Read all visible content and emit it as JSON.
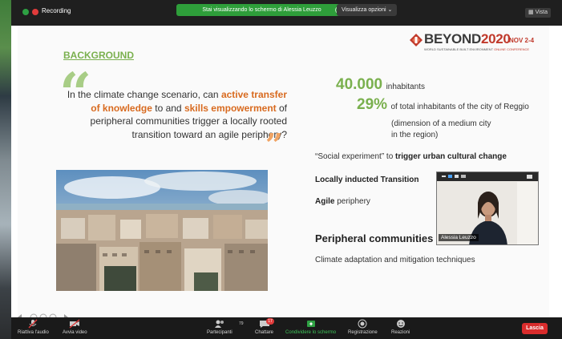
{
  "topbar": {
    "recording_label": "Recording",
    "share_notice": "Stai visualizzando lo schermo di Alessia Leuzzo",
    "view_options": "Visualizza opzioni ⌄",
    "view_button": "Vista"
  },
  "slide": {
    "logo": {
      "title_main": "BEYOND",
      "title_year": "2020",
      "date": "NOV 2-4",
      "subtitle_a": "WORLD SUSTAINABLE BUILT ENVIRONMENT",
      "subtitle_b": "ONLINE CONFERENCE"
    },
    "heading": "BACKGROUND",
    "quote": {
      "part1": "In the climate change scenario, can ",
      "hl1": "active transfer of knowledge",
      "part2": " to and ",
      "hl2": "skills empowerment",
      "part3": " of peripheral communities trigger a locally rooted transition toward an agile periphery?"
    },
    "stats": {
      "num1": "40.000",
      "txt1": "inhabitants",
      "num2": "29%",
      "txt2": "of total inhabitants of the city of Reggio",
      "note": "(dimension of a medium city in the region)"
    },
    "social_prefix": "“Social experiment” to ",
    "social_bold": "trigger urban cultural change",
    "locally": "Locally inducted Transition",
    "agile_bold": "Agile",
    "agile_rest": " periphery",
    "peripheral": "Peripheral communities",
    "climate": "Climate adaptation and mitigation techniques"
  },
  "video": {
    "participant_name": "Alessia Leuzzo"
  },
  "toolbar": {
    "audio": "Riattiva l'audio",
    "video": "Avvia video",
    "participants": "Partecipanti",
    "participants_count": "79",
    "chat": "Chattare",
    "chat_badge": "17",
    "share": "Condividere lo schermo",
    "record": "Registrazione",
    "reactions": "Reazioni",
    "leave": "Lascia"
  },
  "colors": {
    "accent_green": "#7ab04e",
    "accent_orange": "#d86a1f",
    "share_green": "#2e9e3a",
    "leave_red": "#d92c2c"
  }
}
